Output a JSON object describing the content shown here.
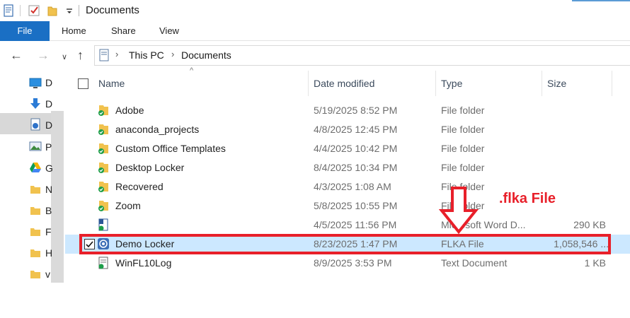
{
  "window": {
    "title": "Documents"
  },
  "ribbon": {
    "tabs": [
      "File",
      "Home",
      "Share",
      "View"
    ]
  },
  "address": {
    "crumbs": [
      "This PC",
      "Documents"
    ]
  },
  "navpane": {
    "letters": [
      "D",
      "D",
      "D",
      "P",
      "G",
      "N",
      "B",
      "F",
      "H",
      "v"
    ]
  },
  "columns": {
    "name": "Name",
    "date": "Date modified",
    "type": "Type",
    "size": "Size"
  },
  "files": [
    {
      "name": "Adobe",
      "date": "5/19/2025 8:52 PM",
      "type": "File folder",
      "size": "",
      "icon": "folder-icon"
    },
    {
      "name": "anaconda_projects",
      "date": "4/8/2025 12:45 PM",
      "type": "File folder",
      "size": "",
      "icon": "folder-icon"
    },
    {
      "name": "Custom Office Templates",
      "date": "4/4/2025 10:42 PM",
      "type": "File folder",
      "size": "",
      "icon": "folder-icon"
    },
    {
      "name": "Desktop Locker",
      "date": "8/4/2025 10:34 PM",
      "type": "File folder",
      "size": "",
      "icon": "folder-icon"
    },
    {
      "name": "Recovered",
      "date": "4/3/2025 1:08 AM",
      "type": "File folder",
      "size": "",
      "icon": "folder-icon"
    },
    {
      "name": "Zoom",
      "date": "5/8/2025 10:55 PM",
      "type": "File folder",
      "size": "",
      "icon": "folder-icon"
    },
    {
      "name": "",
      "date": "4/5/2025 11:56 PM",
      "type": "Microsoft Word D...",
      "size": "290 KB",
      "icon": "word-doc-icon"
    },
    {
      "name": "Demo Locker",
      "date": "8/23/2025 1:47 PM",
      "type": "FLKA File",
      "size": "1,058,546 ...",
      "icon": "flka-file-icon",
      "selected": true
    },
    {
      "name": "WinFL10Log",
      "date": "8/9/2025 3:53 PM",
      "type": "Text Document",
      "size": "1 KB",
      "icon": "text-doc-icon"
    }
  ],
  "annotation": {
    "label": ".flka File",
    "color": "#e8202a"
  },
  "colors": {
    "accent": "#1a6fc4",
    "selection": "#cce8ff"
  }
}
